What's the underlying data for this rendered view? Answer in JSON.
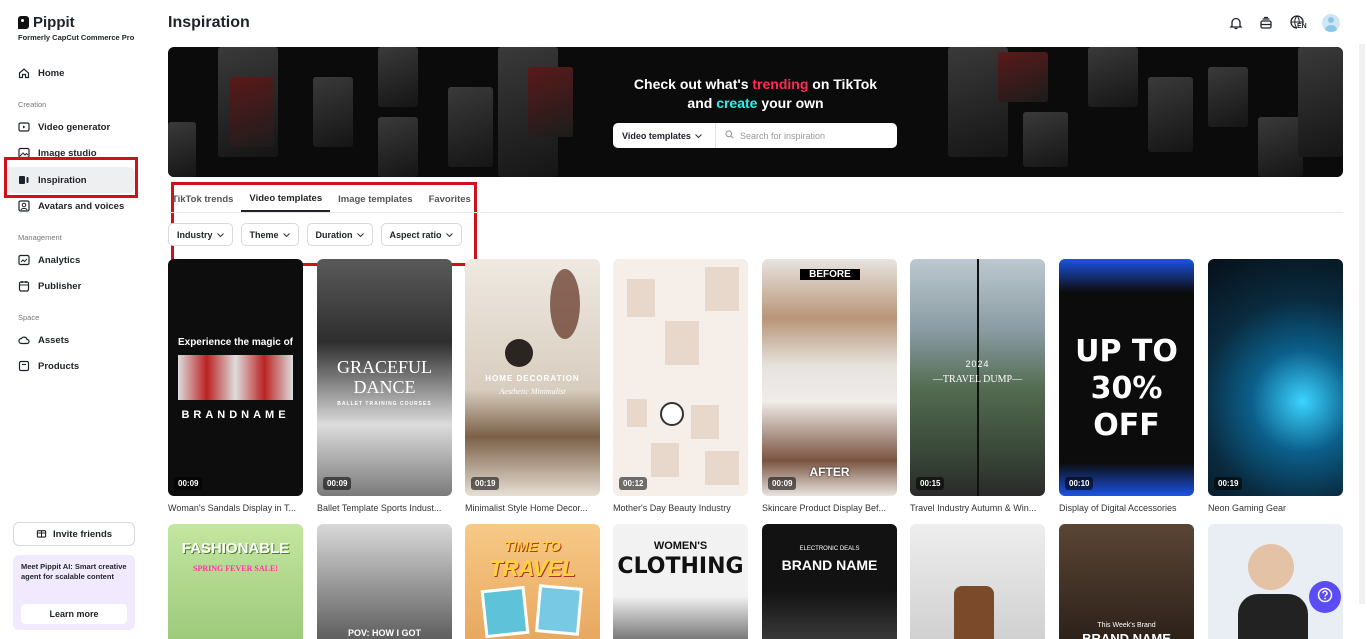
{
  "brand": {
    "name": "Pippit",
    "subtitle": "Formerly CapCut Commerce Pro"
  },
  "sidebar": {
    "home": "Home",
    "section_creation": "Creation",
    "creation_items": [
      "Video generator",
      "Image studio",
      "Inspiration",
      "Avatars and voices"
    ],
    "section_management": "Management",
    "management_items": [
      "Analytics",
      "Publisher"
    ],
    "section_space": "Space",
    "space_items": [
      "Assets",
      "Products"
    ],
    "invite": "Invite friends",
    "promo_text": "Meet Pippit AI: Smart creative agent for scalable content",
    "promo_button": "Learn more"
  },
  "header": {
    "title": "Inspiration",
    "language": "EN"
  },
  "banner": {
    "line1_a": "Check out what's ",
    "line1_b": "trending",
    "line1_c": " on TikTok",
    "line2_a": "and ",
    "line2_b": "create",
    "line2_c": " your own",
    "select_value": "Video templates",
    "search_placeholder": "Search for inspiration"
  },
  "tabs": [
    "TikTok trends",
    "Video templates",
    "Image templates",
    "Favorites"
  ],
  "filters": [
    "Industry",
    "Theme",
    "Duration",
    "Aspect ratio"
  ],
  "templates": [
    {
      "caption": "Woman's Sandals Display in T...",
      "duration": "00:09",
      "overlay": "Experience the magic of",
      "overlay2": "BRANDNAME"
    },
    {
      "caption": "Ballet Template Sports Indust...",
      "duration": "00:09",
      "overlay": "GRACEFUL DANCE",
      "overlay2": "BALLET TRAINING COURSES"
    },
    {
      "caption": "Minimalist Style Home Decor...",
      "duration": "00:19",
      "overlay": "HOME DECORATION",
      "overlay2": "Aesthetic Minimalist"
    },
    {
      "caption": "Mother's Day Beauty Industry",
      "duration": "00:12",
      "overlay": "",
      "overlay2": ""
    },
    {
      "caption": "Skincare Product Display Bef...",
      "duration": "00:09",
      "overlay": "BEFORE",
      "overlay2": "AFTER"
    },
    {
      "caption": "Travel Industry Autumn & Win...",
      "duration": "00:15",
      "overlay": "2024",
      "overlay2": "—TRAVEL DUMP—"
    },
    {
      "caption": "Display of Digital Accessories",
      "duration": "00:10",
      "overlay": "UP TO 30% OFF",
      "overlay2": ""
    },
    {
      "caption": "Neon Gaming Gear",
      "duration": "00:19",
      "overlay": "",
      "overlay2": ""
    }
  ],
  "row2": [
    {
      "overlay": "FASHIONABLE",
      "overlay2": "SPRING FEVER SALE!"
    },
    {
      "overlay": "POV: HOW I GOT",
      "overlay2": ""
    },
    {
      "overlay": "TIME TO",
      "overlay2": "TRAVEL"
    },
    {
      "overlay": "WOMEN'S",
      "overlay2": "CLOTHING"
    },
    {
      "overlay": "ELECTRONIC DEALS",
      "overlay2": "BRAND NAME"
    },
    {
      "overlay": "",
      "overlay2": ""
    },
    {
      "overlay": "This Week's Brand",
      "overlay2": "BRAND NAME"
    },
    {
      "overlay": "",
      "overlay2": ""
    }
  ],
  "colors": {
    "highlight": "#d0101b",
    "tiktok_red": "#fe2c55",
    "tiktok_cyan": "#25f4ee",
    "help": "#5b4cf5",
    "promo_bg": "#f1eaff"
  }
}
